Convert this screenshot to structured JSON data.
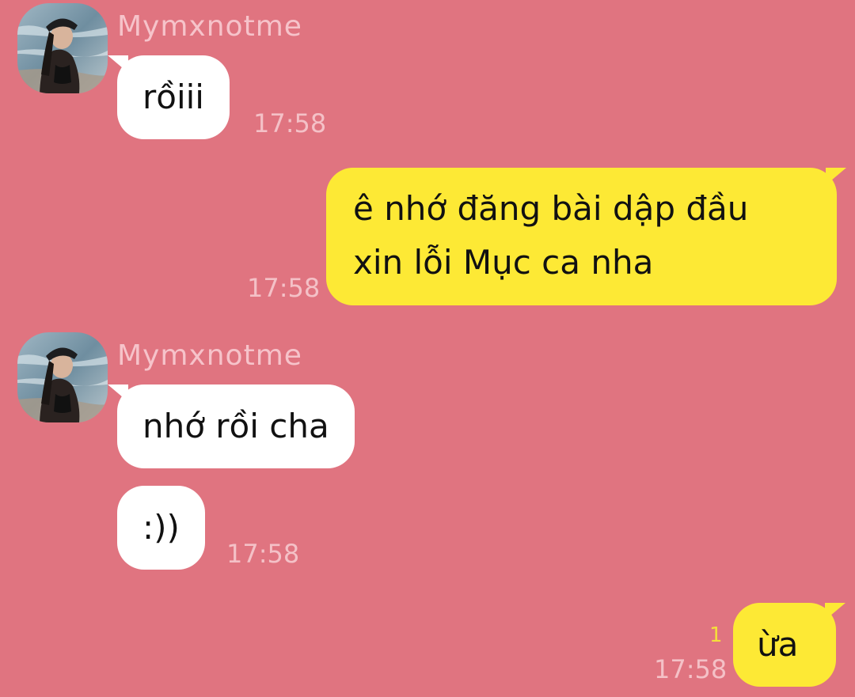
{
  "chat": {
    "messages": [
      {
        "sender": "Mymxnotme",
        "text": "rồiii",
        "time": "17:58"
      },
      {
        "text_line1": "ê nhớ đăng bài dập đầu",
        "text_line2": "xin lỗi Mục ca nha",
        "time": "17:58"
      },
      {
        "sender": "Mymxnotme",
        "text": "nhớ rồi cha"
      },
      {
        "text": ":))",
        "time": "17:58"
      },
      {
        "text": "ừa",
        "time": "17:58",
        "unread_count": "1"
      }
    ]
  },
  "colors": {
    "background": "#e07480",
    "incoming_bubble": "#ffffff",
    "outgoing_bubble": "#fde935",
    "sender_name": "#f6c3ca",
    "timestamp": "#f4c1c7",
    "unread": "#f5df3a"
  },
  "icons": {
    "avatar": "profile-photo"
  }
}
